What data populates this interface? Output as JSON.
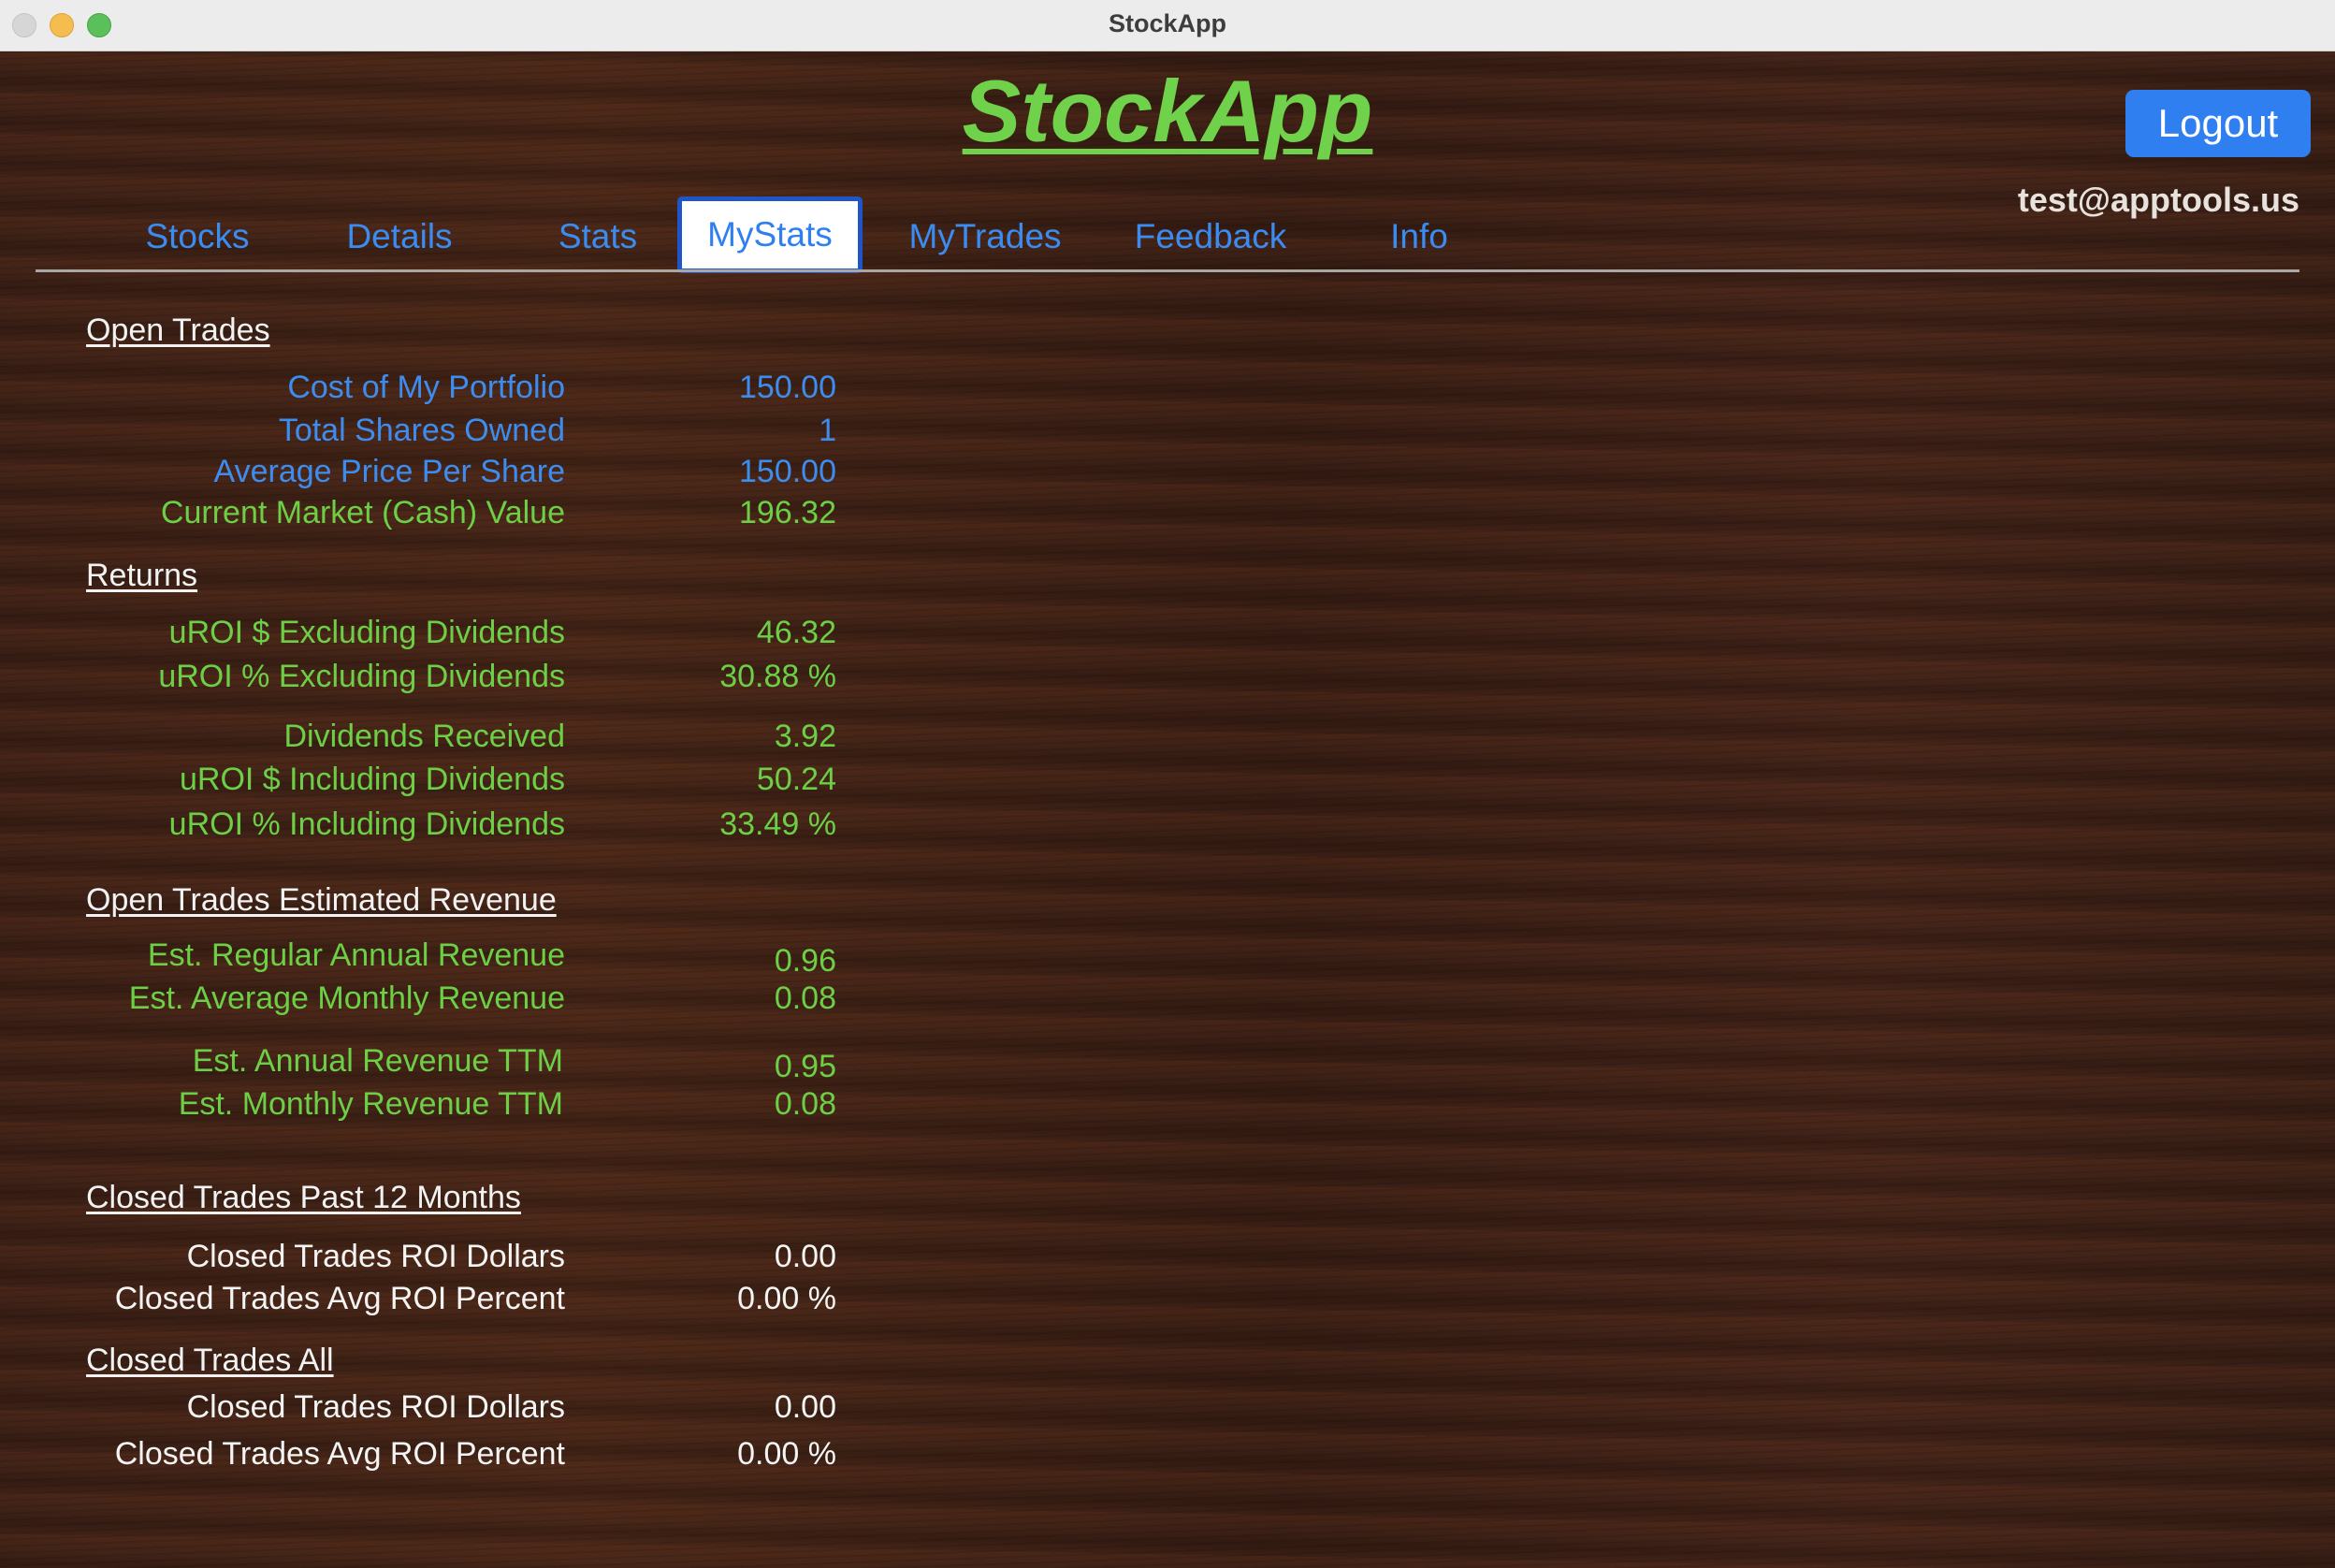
{
  "window": {
    "title": "StockApp"
  },
  "header": {
    "logo": "StockApp",
    "logout_label": "Logout",
    "user_email": "test@apptools.us"
  },
  "tabs": [
    {
      "label": "Stocks",
      "active": false
    },
    {
      "label": "Details",
      "active": false
    },
    {
      "label": "Stats",
      "active": false
    },
    {
      "label": "MyStats",
      "active": true
    },
    {
      "label": "MyTrades",
      "active": false
    },
    {
      "label": "Feedback",
      "active": false
    },
    {
      "label": "Info",
      "active": false
    }
  ],
  "colors": {
    "logo_green": "#6fd24a",
    "link_blue": "#3b8cf0",
    "value_green": "#6ccf45",
    "logout_blue": "#2f7ff0"
  },
  "sections": {
    "open_trades": {
      "title": "Open Trades",
      "rows": [
        {
          "label": "Cost of My Portfolio",
          "value": "150.00"
        },
        {
          "label": "Total Shares Owned",
          "value": "1"
        },
        {
          "label": "Average Price Per Share",
          "value": "150.00"
        },
        {
          "label": "Current Market (Cash) Value",
          "value": "196.32"
        }
      ]
    },
    "returns": {
      "title": "Returns",
      "rows": [
        {
          "label": "uROI $ Excluding Dividends",
          "value": "46.32"
        },
        {
          "label": "uROI % Excluding Dividends",
          "value": "30.88 %"
        },
        {
          "label": "Dividends Received",
          "value": "3.92"
        },
        {
          "label": "uROI $ Including Dividends",
          "value": "50.24"
        },
        {
          "label": "uROI % Including Dividends",
          "value": "33.49 %"
        }
      ]
    },
    "estimated_revenue": {
      "title": "Open Trades Estimated Revenue",
      "rows": [
        {
          "label": "Est. Regular Annual Revenue",
          "value": "0.96"
        },
        {
          "label": "Est. Average Monthly Revenue",
          "value": "0.08"
        },
        {
          "label": "Est. Annual Revenue TTM",
          "value": "0.95"
        },
        {
          "label": "Est. Monthly Revenue TTM",
          "value": "0.08"
        }
      ]
    },
    "closed_12m": {
      "title": "Closed Trades Past 12 Months",
      "rows": [
        {
          "label": "Closed Trades ROI Dollars",
          "value": "0.00"
        },
        {
          "label": "Closed Trades Avg ROI Percent",
          "value": "0.00 %"
        }
      ]
    },
    "closed_all": {
      "title": "Closed Trades All",
      "rows": [
        {
          "label": "Closed Trades ROI Dollars",
          "value": "0.00"
        },
        {
          "label": "Closed Trades Avg ROI Percent",
          "value": "0.00 %"
        }
      ]
    }
  }
}
